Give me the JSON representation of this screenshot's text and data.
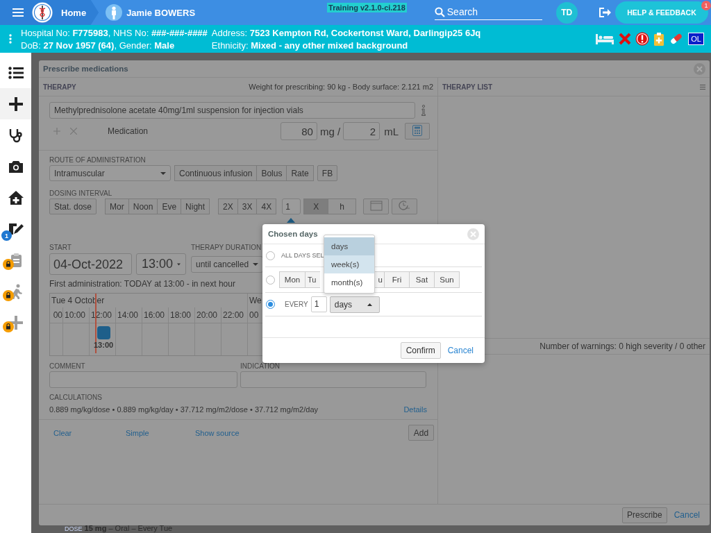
{
  "header": {
    "home": "Home",
    "patient_name": "Jamie BOWERS",
    "version": "Training v2.1.0-ci.218",
    "search": {
      "placeholder": "Search"
    },
    "user_initials": "TD",
    "help_button": "HELP & FEEDBACK",
    "help_badge": "1"
  },
  "patient_banner": {
    "columns": [
      [
        "Hospital No: **F775983**, NHS No: **###-###-####**",
        "DoB: **27 Nov 1957 (64)**, Gender: **Male**"
      ],
      [
        "Address: **7523 Kempton Rd, Cockertonst Ward, Darlingip25 6Jq**",
        "Ethnicity: **Mixed - any other mixed background**"
      ]
    ],
    "badge": "OL"
  },
  "sidebar": {
    "items": [
      {
        "kind": "list",
        "selected": false,
        "locked": false
      },
      {
        "kind": "add",
        "selected": true,
        "locked": false
      },
      {
        "kind": "stethoscope",
        "selected": false,
        "locked": false
      },
      {
        "kind": "camera",
        "selected": false,
        "locked": false
      },
      {
        "kind": "home",
        "selected": false,
        "locked": false
      },
      {
        "kind": "edit",
        "selected": false,
        "locked": false,
        "badge": "1"
      },
      {
        "kind": "clipboard",
        "selected": false,
        "locked": true
      },
      {
        "kind": "walk",
        "selected": false,
        "locked": true
      },
      {
        "kind": "plus",
        "selected": false,
        "locked": true
      }
    ]
  },
  "background": {
    "label": "DOSE",
    "text": "**15 mg** – Oral – Every Tue"
  },
  "modal": {
    "title": "Prescribe medications",
    "therapy": {
      "heading": "THERAPY",
      "weight_info": "Weight for prescribing: 90 kg - Body surface: 2.121 m2",
      "medication": "Methylprednisolone acetate 40mg/1ml suspension for injection vials",
      "medication_label": "Medication",
      "dose": "80",
      "dose_unit": "mg /",
      "volume": "2",
      "volume_unit": "mL",
      "route_label": "ROUTE OF ADMINISTRATION",
      "route": "Intramuscular",
      "route_buttons": [
        "Continuous infusion",
        "Bolus",
        "Rate"
      ],
      "fb": "FB",
      "dosing_label": "DOSING INTERVAL",
      "stat": "Stat. dose",
      "times": [
        "Mor",
        "Noon",
        "Eve",
        "Night"
      ],
      "multipliers": [
        "2X",
        "3X",
        "4X"
      ],
      "interval_value": "1",
      "interval_units": [
        {
          "label": "X",
          "selected": true
        },
        {
          "label": "h",
          "selected": false
        }
      ],
      "start_label": "START",
      "start_date": "04-Oct-2022",
      "start_time": "13:00",
      "duration_label": "THERAPY DURATION",
      "duration": "until cancelled",
      "first_admin": "First administration: TODAY at 13:00 - in next hour",
      "timeline": {
        "day": "Tue 4 October",
        "next_day": "We",
        "hours": [
          "00",
          "10:00",
          "12:00",
          "14:00",
          "16:00",
          "18:00",
          "20:00",
          "22:00",
          "00"
        ],
        "dose_time": "13:00"
      },
      "comment_label": "COMMENT",
      "indication_label": "INDICATION",
      "calc_label": "CALCULATIONS",
      "calculations": "0.889 mg/kg/dose • 0.889 mg/kg/day • 37.712 mg/m2/dose • 37.712 mg/m2/day",
      "details": "Details",
      "footer_links": [
        "Clear",
        "Simple",
        "Show source"
      ],
      "add": "Add"
    },
    "therapy_list": {
      "heading": "THERAPY LIST",
      "warnings": "Number of warnings: 0 high severity / 0 other"
    },
    "prescribe": "Prescribe",
    "cancel": "Cancel"
  },
  "dialog": {
    "title": "Chosen days",
    "all_days": "ALL DAYS SEL",
    "weekdays": [
      "Mon",
      "Tu",
      "u",
      "Fri",
      "Sat",
      "Sun"
    ],
    "every_label": "EVERY",
    "every_value": "1",
    "unit": "days",
    "options": [
      {
        "selected": false
      },
      {
        "selected": false
      },
      {
        "selected": true
      }
    ],
    "unit_options": [
      {
        "label": "days",
        "selected": true,
        "highlighted": false
      },
      {
        "label": "week(s)",
        "selected": false,
        "highlighted": true
      },
      {
        "label": "month(s)",
        "selected": false,
        "highlighted": false
      }
    ],
    "confirm": "Confirm",
    "cancel": "Cancel"
  }
}
